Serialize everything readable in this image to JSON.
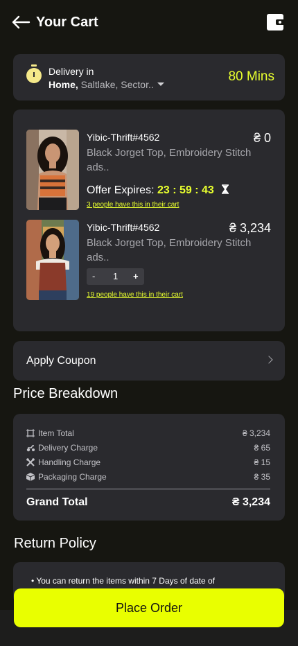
{
  "header": {
    "title": "Your Cart"
  },
  "delivery": {
    "label": "Delivery in",
    "location_bold": "Home,",
    "location_rest": " Saltlake, Sector..",
    "eta": "80 Mins"
  },
  "cart": {
    "items": [
      {
        "name": "Yibic-Thrift#4562",
        "price": "₴ 0",
        "desc": "Black Jorget Top, Embroidery Stitch ads..",
        "offer_label": "Offer Expires:",
        "countdown": "23 : 59 : 43",
        "people": "3 people have this in their cart"
      },
      {
        "name": "Yibic-Thrift#4562",
        "price": "₴ 3,234",
        "desc": "Black Jorget Top, Embroidery Stitch ads..",
        "qty_minus": "-",
        "qty": "1",
        "qty_plus": "+",
        "people": "19 people have this in their cart"
      }
    ]
  },
  "coupon": {
    "label": "Apply Coupon"
  },
  "price": {
    "heading": "Price Breakdown",
    "rows": [
      {
        "label": "Item Total",
        "value": "₴ 3,234"
      },
      {
        "label": "Delivery Charge",
        "value": "₴ 65"
      },
      {
        "label": "Handling Charge",
        "value": "₴ 15"
      },
      {
        "label": "Packaging Charge",
        "value": "₴ 35"
      }
    ],
    "grand_label": "Grand Total",
    "grand_value": "₴ 3,234"
  },
  "policy": {
    "heading": "Return Policy",
    "text": "•  You can return the items within 7 Days of date of"
  },
  "cta": {
    "label": "Place Order"
  },
  "colors": {
    "accent": "#e9ff00",
    "card": "#2a2a2e",
    "bg": "#161611"
  }
}
